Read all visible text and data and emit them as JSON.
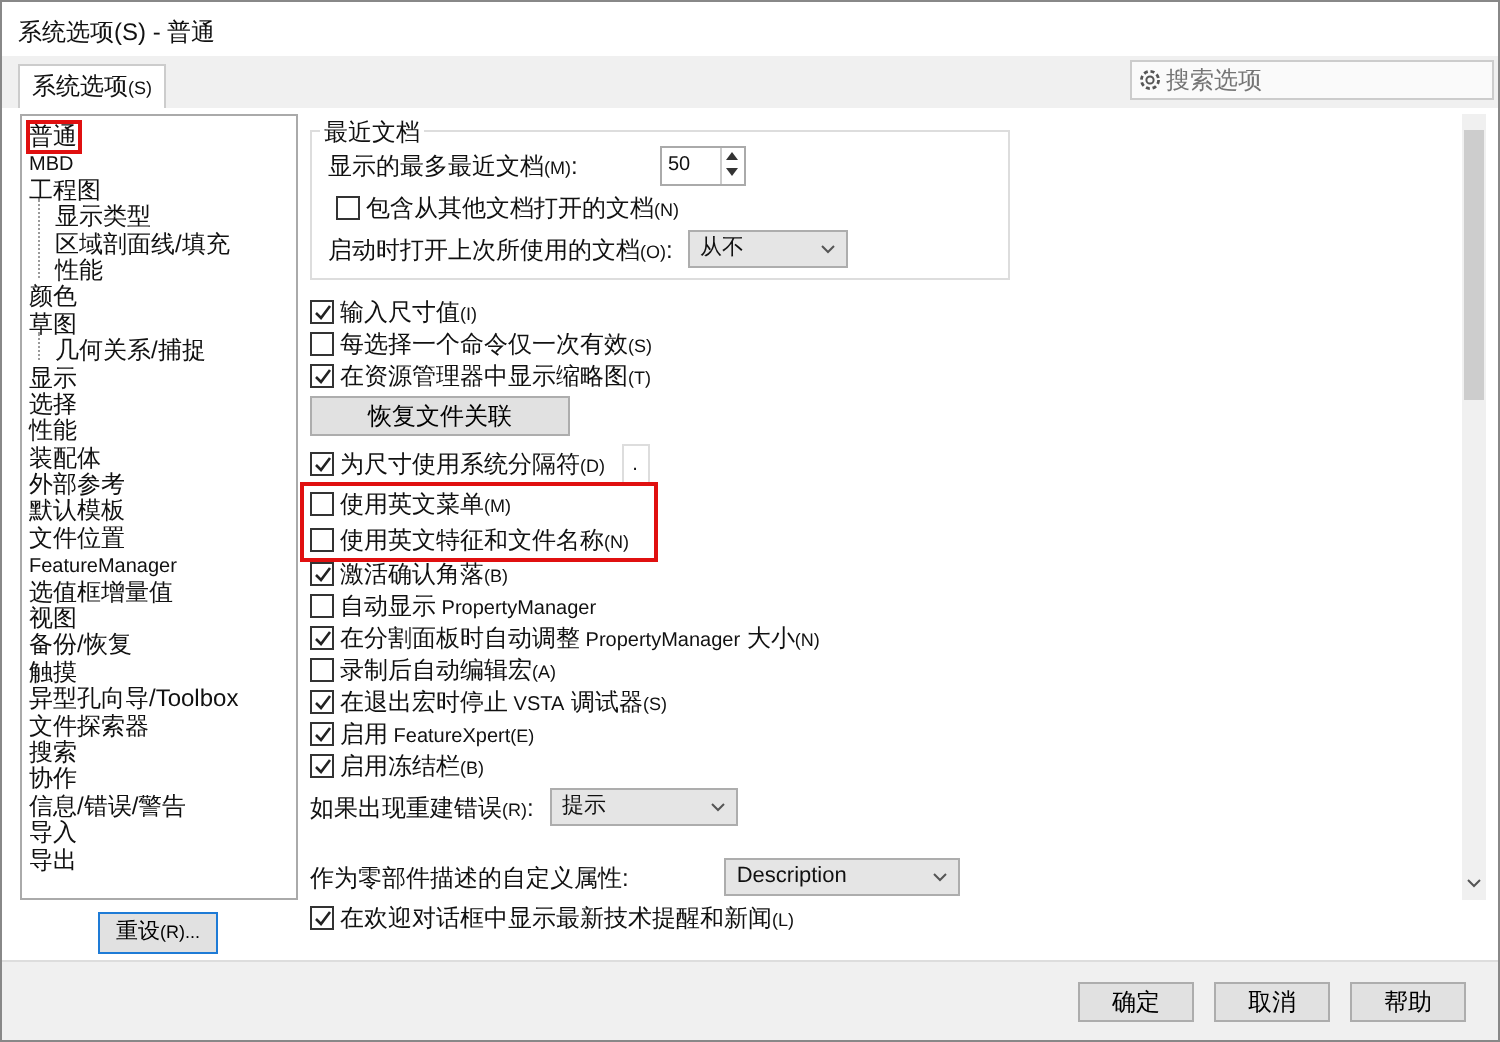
{
  "window": {
    "title": "系统选项(S) - 普通"
  },
  "tabs": [
    {
      "label": "系统选项",
      "key": "(S)",
      "selected": true
    }
  ],
  "search": {
    "placeholder": "搜索选项"
  },
  "tree": [
    {
      "label": "普通",
      "highlighted": true
    },
    {
      "label": "MBD"
    },
    {
      "label": "工程图",
      "children": [
        {
          "label": "显示类型"
        },
        {
          "label": "区域剖面线/填充"
        },
        {
          "label": "性能"
        }
      ]
    },
    {
      "label": "颜色"
    },
    {
      "label": "草图",
      "children": [
        {
          "label": "几何关系/捕捉"
        }
      ]
    },
    {
      "label": "显示"
    },
    {
      "label": "选择"
    },
    {
      "label": "性能"
    },
    {
      "label": "装配体"
    },
    {
      "label": "外部参考"
    },
    {
      "label": "默认模板"
    },
    {
      "label": "文件位置"
    },
    {
      "label": "FeatureManager"
    },
    {
      "label": "选值框增量值"
    },
    {
      "label": "视图"
    },
    {
      "label": "备份/恢复"
    },
    {
      "label": "触摸"
    },
    {
      "label": "异型孔向导/Toolbox"
    },
    {
      "label": "文件探索器"
    },
    {
      "label": "搜索"
    },
    {
      "label": "协作"
    },
    {
      "label": "信息/错误/警告"
    },
    {
      "label": "导入"
    },
    {
      "label": "导出"
    }
  ],
  "reset_button": {
    "label": "重设",
    "key": "(R)..."
  },
  "recent_group": {
    "title": "最近文档",
    "max_label": "显示的最多最近文档",
    "max_key": "(M)",
    "max_colon": ":",
    "max_value": "50",
    "include": {
      "label": "包含从其他文档打开的文档",
      "key": "(N)",
      "checked": false
    },
    "open_label": "启动时打开上次所使用的文档",
    "open_key": "(O)",
    "open_colon": ":",
    "open_value": "从不"
  },
  "options": [
    {
      "kind": "checkbox",
      "label": "输入尺寸值",
      "key": "(I)",
      "checked": true,
      "highlighted": false
    },
    {
      "kind": "checkbox",
      "label": "每选择一个命令仅一次有效",
      "key": "(S)",
      "checked": false,
      "highlighted": false
    },
    {
      "kind": "checkbox",
      "label": "在资源管理器中显示缩略图",
      "key": "(T)",
      "checked": true,
      "highlighted": false
    },
    {
      "kind": "button",
      "label": "恢复文件关联"
    },
    {
      "kind": "checkbox",
      "label": "为尺寸使用系统分隔符",
      "key": "(D)",
      "checked": true,
      "highlighted": false,
      "field": "."
    },
    {
      "kind": "checkbox",
      "label": "使用英文菜单",
      "key": "(M)",
      "checked": false,
      "highlighted": true
    },
    {
      "kind": "checkbox",
      "label": "使用英文特征和文件名称",
      "key": "(N)",
      "checked": false,
      "highlighted": true
    },
    {
      "kind": "checkbox",
      "label": "激活确认角落",
      "key": "(B)",
      "checked": true,
      "highlighted": false
    },
    {
      "kind": "checkbox",
      "label": "自动显示 PropertyManager",
      "checked": false,
      "highlighted": false
    },
    {
      "kind": "checkbox",
      "label": "在分割面板时自动调整 PropertyManager 大小",
      "key": "(N)",
      "checked": true,
      "highlighted": false
    },
    {
      "kind": "checkbox",
      "label": "录制后自动编辑宏",
      "key": "(A)",
      "checked": false,
      "highlighted": false
    },
    {
      "kind": "checkbox",
      "label": "在退出宏时停止 VSTA 调试器",
      "key": "(S)",
      "checked": true,
      "highlighted": false
    },
    {
      "kind": "checkbox",
      "label": "启用 FeatureXpert",
      "key": "(E)",
      "checked": true,
      "highlighted": false
    },
    {
      "kind": "checkbox",
      "label": "启用冻结栏",
      "key": "(B)",
      "checked": true,
      "highlighted": false
    },
    {
      "kind": "select",
      "label": "如果出现重建错误",
      "key": "(R)",
      "colon": ":",
      "value": "提示"
    },
    {
      "kind": "select",
      "label": "作为零部件描述的自定义属性",
      "colon": ":",
      "value": "Description"
    },
    {
      "kind": "checkbox",
      "label": "在欢迎对话框中显示最新技术提醒和新闻",
      "key": "(L)",
      "checked": true,
      "highlighted": false
    }
  ],
  "buttons": [
    {
      "label": "确定"
    },
    {
      "label": "取消"
    },
    {
      "label": "帮助"
    }
  ]
}
